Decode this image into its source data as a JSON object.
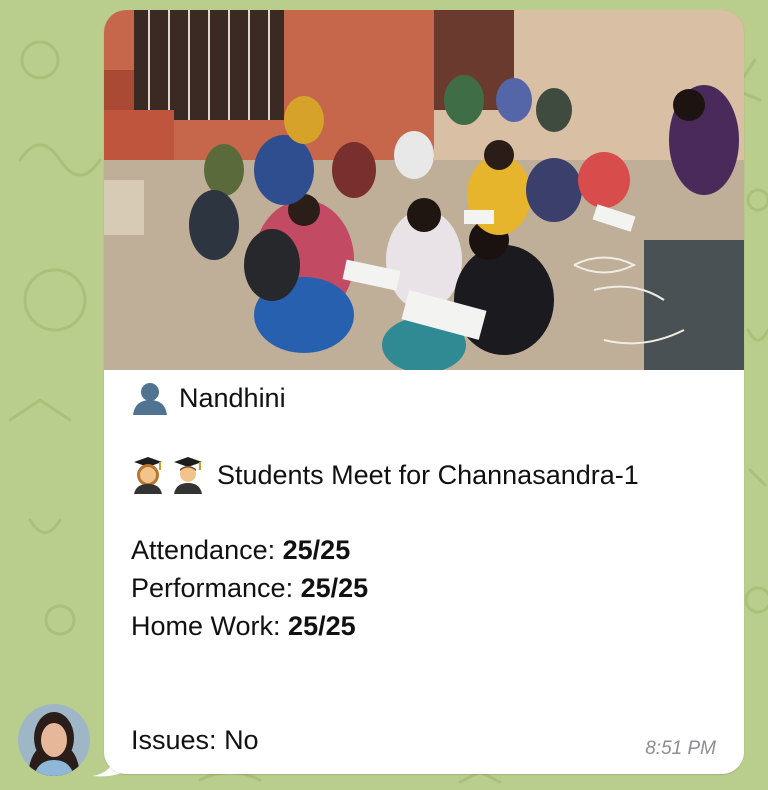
{
  "message": {
    "sender_name": "Nandhini",
    "title": "Students Meet for Channasandra-1",
    "attendance_label": "Attendance:",
    "attendance_value": "25/25",
    "performance_label": "Performance:",
    "performance_value": "25/25",
    "homework_label": "Home Work:",
    "homework_value": "25/25",
    "issues_label": "Issues:",
    "issues_value": "No",
    "time": "8:51 PM"
  },
  "icons": {
    "sender": "bust-in-silhouette-icon",
    "title": [
      "woman-student-icon",
      "man-student-icon"
    ],
    "avatar": "sender-avatar"
  },
  "colors": {
    "wallpaper": "#b9cd8c",
    "bubble": "#ffffff",
    "timestamp": "#8e8e93"
  }
}
